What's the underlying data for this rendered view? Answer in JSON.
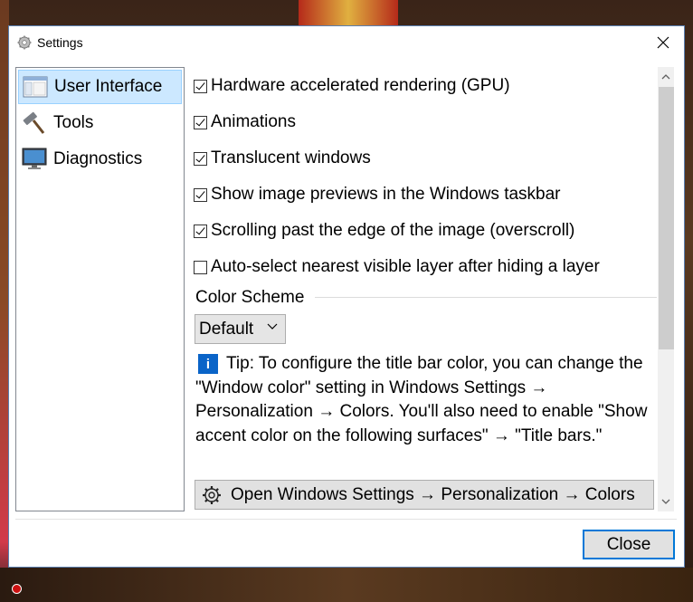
{
  "window": {
    "title": "Settings",
    "close_glyph": "✕"
  },
  "nav": {
    "items": [
      {
        "label": "User Interface",
        "icon": "window-icon",
        "selected": true
      },
      {
        "label": "Tools",
        "icon": "hammer-icon",
        "selected": false
      },
      {
        "label": "Diagnostics",
        "icon": "monitor-icon",
        "selected": false
      }
    ]
  },
  "options": [
    {
      "label": "Hardware accelerated rendering (GPU)",
      "checked": true
    },
    {
      "label": "Animations",
      "checked": true
    },
    {
      "label": "Translucent windows",
      "checked": true
    },
    {
      "label": "Show image previews in the Windows taskbar",
      "checked": true
    },
    {
      "label": "Scrolling past the edge of the image (overscroll)",
      "checked": true
    },
    {
      "label": "Auto-select nearest visible layer after hiding a layer",
      "checked": false
    }
  ],
  "color_scheme": {
    "group_label": "Color Scheme",
    "selected": "Default"
  },
  "tip": {
    "icon_glyph": "i",
    "text": "Tip: To configure the title bar color, you can change the \"Window color\" setting in Windows Settings → Personalization → Colors. You'll also need to enable \"Show accent color on the following surfaces\" → \"Title bars.\""
  },
  "open_settings_button": {
    "label": "Open Windows Settings → Personalization → Colors"
  },
  "footer": {
    "close_label": "Close"
  },
  "colors": {
    "selection_bg": "#cce8ff",
    "accent_border": "#0078d7",
    "tip_icon": "#0a64c8"
  }
}
